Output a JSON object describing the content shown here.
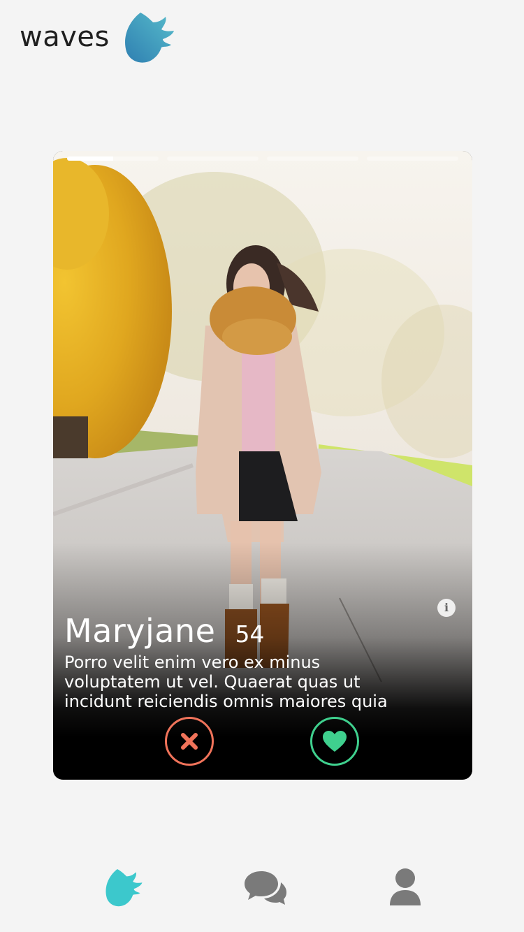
{
  "app": {
    "brand_name": "waves",
    "logo_icon": "wave-flame-logo-icon"
  },
  "card": {
    "name": "Maryjane",
    "age": "54",
    "bio": "Porro velit enim vero ex minus voluptatem ut vel. Quaerat quas ut incidunt reiciendis omnis maiores quia",
    "photo_count": 4,
    "current_photo": 1,
    "first_photo_progress": 0.5,
    "info_label": "i"
  },
  "actions": {
    "dislike_icon": "close-icon",
    "like_icon": "heart-icon"
  },
  "bottom_nav": {
    "items": [
      {
        "icon": "wave-flame-icon",
        "active": true
      },
      {
        "icon": "chat-bubbles-icon",
        "active": false
      },
      {
        "icon": "user-icon",
        "active": false
      }
    ]
  },
  "colors": {
    "background": "#f4f4f4",
    "logo_gradient_start": "#2f7fb1",
    "logo_gradient_end": "#52b5c8",
    "nav_active": "#3cc8cc",
    "nav_inactive": "#7a7a7a",
    "dislike": "#f0735a",
    "like": "#3fd08e"
  }
}
